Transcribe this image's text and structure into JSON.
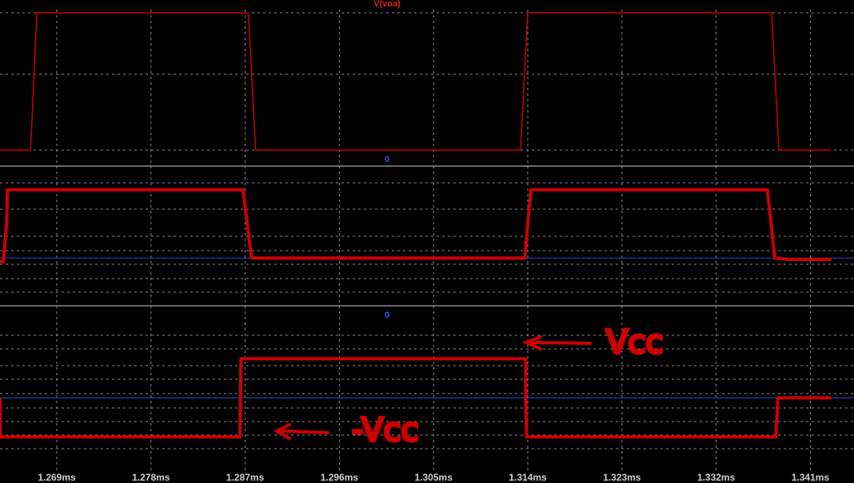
{
  "app": {
    "title": "V(voa)",
    "background": "#000000",
    "trace_color": "#cc0000",
    "zero_line_color": "#1f4fd8",
    "grid_color": "#8a8a8a",
    "title_color": "#dd2222",
    "zero_label_color": "#2a5cff"
  },
  "chart_data": [
    {
      "type": "line",
      "title": "V(voa)",
      "ylim": [
        0,
        1
      ],
      "grid": true,
      "series": [
        {
          "values_x": [
            1.263,
            1.2665,
            1.2671,
            1.2873,
            1.288,
            1.3133,
            1.314,
            1.3373,
            1.338,
            1.343
          ],
          "values_y": [
            0,
            0,
            1,
            1,
            0,
            0,
            1,
            1,
            0,
            0
          ]
        }
      ]
    },
    {
      "type": "line",
      "title": "0",
      "ylim": [
        -0.3,
        1.1
      ],
      "grid": true,
      "zero_line": true,
      "series": [
        {
          "values_x": [
            1.263,
            1.2639,
            1.2642,
            1.2643,
            1.2868,
            1.2876,
            1.3137,
            1.3143,
            1.3369,
            1.3376,
            1.339,
            1.343
          ],
          "values_y": [
            -0.05,
            -0.05,
            0.5,
            1.0,
            1.0,
            0.0,
            0.0,
            1.0,
            1.0,
            0.0,
            -0.02,
            -0.02
          ]
        }
      ]
    },
    {
      "type": "line",
      "title": "0",
      "ylim": [
        -1.3,
        1.6
      ],
      "grid": true,
      "zero_line": true,
      "series": [
        {
          "values_x": [
            1.263,
            1.2635,
            1.2636,
            1.2865,
            1.2866,
            1.3138,
            1.3138,
            1.3139,
            1.3377,
            1.3379,
            1.343
          ],
          "values_y": [
            0,
            0,
            -1,
            -1,
            1,
            1,
            0,
            -1,
            -1,
            0,
            0
          ]
        }
      ]
    }
  ],
  "x_axis": {
    "ticks": [
      1.269,
      1.278,
      1.287,
      1.296,
      1.305,
      1.314,
      1.323,
      1.332,
      1.341
    ],
    "tick_labels": [
      "1.269ms",
      "1.278ms",
      "1.287ms",
      "1.296ms",
      "1.305ms",
      "1.314ms",
      "1.323ms",
      "1.332ms",
      "1.341ms"
    ]
  },
  "annotations": {
    "vcc_label": "Vcc",
    "neg_vcc_label": "-Vcc"
  }
}
